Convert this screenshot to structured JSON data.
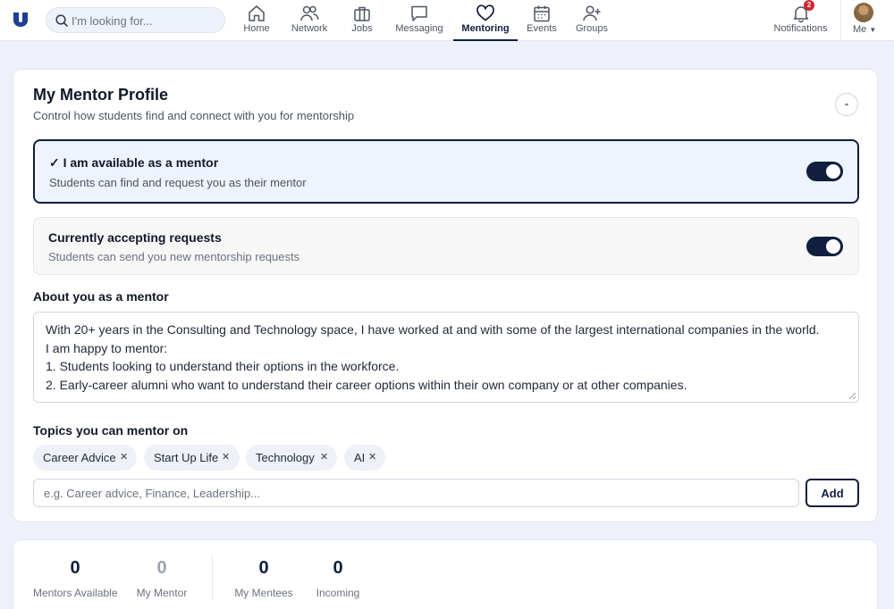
{
  "search": {
    "placeholder": "I'm looking for..."
  },
  "nav": [
    {
      "label": "Home",
      "icon": "home-icon"
    },
    {
      "label": "Network",
      "icon": "people-icon"
    },
    {
      "label": "Jobs",
      "icon": "briefcase-icon"
    },
    {
      "label": "Messaging",
      "icon": "chat-icon"
    },
    {
      "label": "Mentoring",
      "icon": "heart-icon",
      "active": true
    },
    {
      "label": "Events",
      "icon": "calendar-icon"
    },
    {
      "label": "Groups",
      "icon": "add-user-icon"
    }
  ],
  "notifications": {
    "label": "Notifications",
    "count": "2"
  },
  "me": {
    "label": "Me"
  },
  "profile": {
    "title": "My Mentor Profile",
    "subtitle": "Control how students find and connect with you for mentorship",
    "available": {
      "title": "✓ I am available as a mentor",
      "desc": "Students can find and request you as their mentor",
      "on": true
    },
    "accepting": {
      "title": "Currently accepting requests",
      "desc": "Students can send you new mentorship requests",
      "on": true
    },
    "about_label": "About you as a mentor",
    "about_lines": [
      "With 20+ years in the Consulting and Technology space, I have worked at and with some of the largest international companies in the world.",
      "I am happy to mentor:",
      "1. Students looking to understand their options in the workforce.",
      "2. Early-career alumni who want to understand their career options within their own company or at other companies."
    ],
    "topics_label": "Topics you can mentor on",
    "topics": [
      "Career Advice",
      "Start Up Life",
      "Technology",
      "AI"
    ],
    "topic_placeholder": "e.g. Career advice, Finance, Leadership...",
    "add_label": "Add"
  },
  "stats": [
    {
      "value": "0",
      "label": "Mentors Available"
    },
    {
      "value": "0",
      "label": "My Mentor"
    },
    {
      "value": "0",
      "label": "My Mentees"
    },
    {
      "value": "0",
      "label": "Incoming"
    }
  ],
  "colors": {
    "accent": "#0f1f3d",
    "badge": "#d1242f",
    "page_bg": "#eef1fb"
  }
}
